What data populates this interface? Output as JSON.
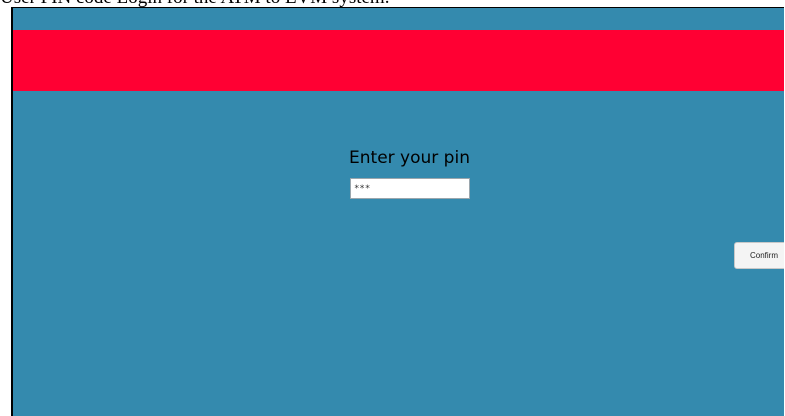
{
  "caption": "User PIN code Login for the ATM to EVM system.",
  "banner": {
    "color": "#ff0033"
  },
  "main": {
    "background": "#348aae",
    "prompt": "Enter your pin",
    "pin_value": "***"
  },
  "actions": {
    "confirm_label": "Confirm"
  }
}
